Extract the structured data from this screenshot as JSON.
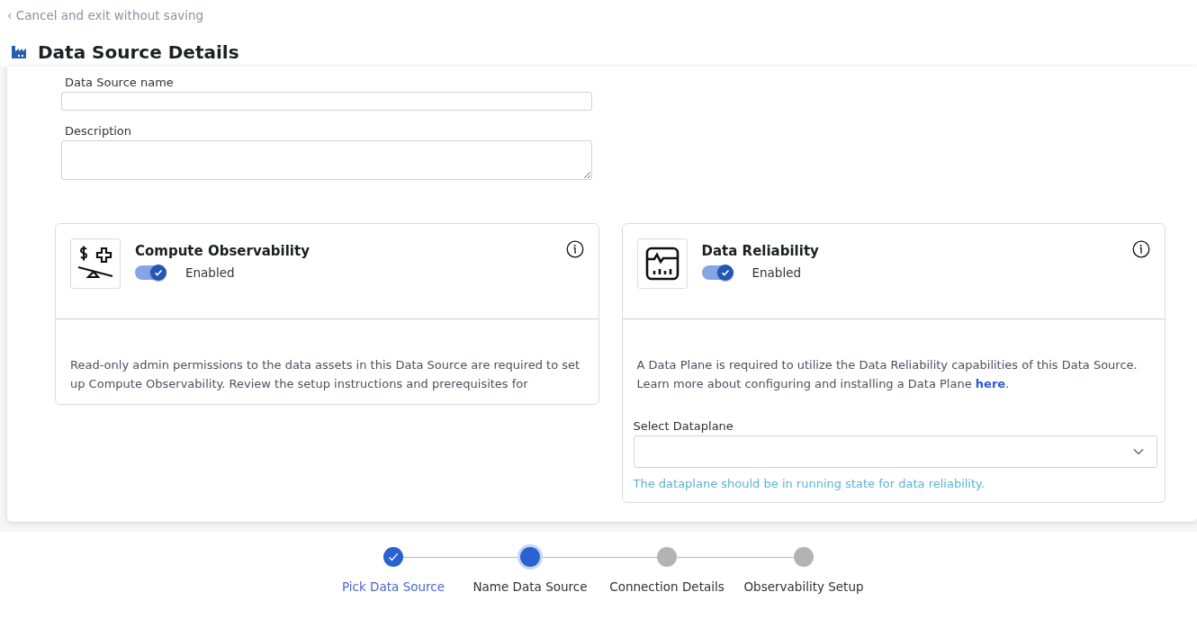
{
  "back_link": {
    "icon": "‹",
    "label": "Cancel and exit without saving"
  },
  "page_title": "Data Source Details",
  "form": {
    "fields": [
      {
        "label": "Data Source name",
        "kind": "text"
      },
      {
        "label": "Description",
        "kind": "textarea"
      }
    ]
  },
  "cards": [
    {
      "kind": "compute",
      "title": "Compute Observability",
      "toggle": {
        "on": true,
        "label": "Enabled"
      },
      "description": "Read-only admin permissions to the data assets in this Data Source are required to set up Compute Observability. Review the setup instructions and prerequisites for"
    },
    {
      "kind": "reliability",
      "title": "Data Reliability",
      "toggle": {
        "on": true,
        "label": "Enabled"
      },
      "description": "A Data Plane is required to utilize the Data Reliability capabilities of this Data Source. Learn more about configuring and installing a Data Plane ",
      "link": "here",
      "description_end": ".",
      "select": {
        "label": "Select Dataplane",
        "hint": "The dataplane should be in running state for data reliability."
      }
    }
  ],
  "steps": [
    {
      "label": "Pick Data Source",
      "kind": "done"
    },
    {
      "label": "Name Data Source",
      "kind": "current"
    },
    {
      "label": "Connection Details",
      "kind": "pending"
    },
    {
      "label": "Observability Setup",
      "kind": "pending"
    }
  ]
}
